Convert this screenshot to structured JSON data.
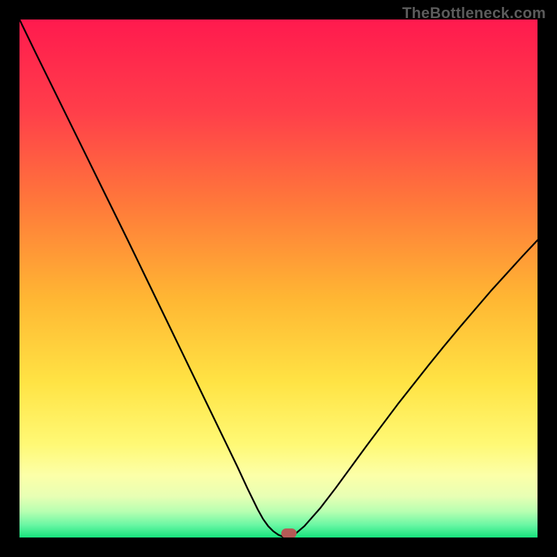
{
  "watermark": "TheBottleneck.com",
  "chart_data": {
    "type": "line",
    "title": "",
    "xlabel": "",
    "ylabel": "",
    "xlim": [
      0,
      100
    ],
    "ylim": [
      0,
      100
    ],
    "grid": false,
    "legend": false,
    "curve_x": [
      0,
      3,
      6,
      9,
      12,
      15,
      18,
      21,
      24,
      27,
      30,
      33,
      36,
      39,
      42,
      44,
      46,
      47,
      48,
      49,
      50,
      51,
      52,
      53,
      55,
      58,
      61,
      64,
      67,
      70,
      73,
      76,
      79,
      82,
      85,
      88,
      91,
      94,
      97,
      100
    ],
    "curve_y": [
      100,
      93.8,
      87.7,
      81.6,
      75.5,
      69.4,
      63.3,
      57.2,
      51.0,
      44.8,
      38.6,
      32.4,
      26.2,
      20.0,
      13.8,
      9.5,
      5.4,
      3.6,
      2.2,
      1.2,
      0.5,
      0.1,
      0.0,
      0.5,
      2.2,
      5.6,
      9.5,
      13.6,
      17.7,
      21.7,
      25.7,
      29.5,
      33.3,
      37.0,
      40.6,
      44.1,
      47.6,
      50.9,
      54.2,
      57.4
    ],
    "marker": {
      "x": 52,
      "y": 0,
      "color": "#b55a56"
    },
    "gradient_stops": [
      {
        "pos": 0.0,
        "color": "#ff1a4e"
      },
      {
        "pos": 0.18,
        "color": "#ff3f4a"
      },
      {
        "pos": 0.36,
        "color": "#ff7a3a"
      },
      {
        "pos": 0.54,
        "color": "#ffb733"
      },
      {
        "pos": 0.7,
        "color": "#ffe344"
      },
      {
        "pos": 0.82,
        "color": "#fff975"
      },
      {
        "pos": 0.88,
        "color": "#fcffa8"
      },
      {
        "pos": 0.92,
        "color": "#e8ffb4"
      },
      {
        "pos": 0.95,
        "color": "#b7ffb1"
      },
      {
        "pos": 0.975,
        "color": "#6cf7a4"
      },
      {
        "pos": 1.0,
        "color": "#17e57e"
      }
    ]
  }
}
